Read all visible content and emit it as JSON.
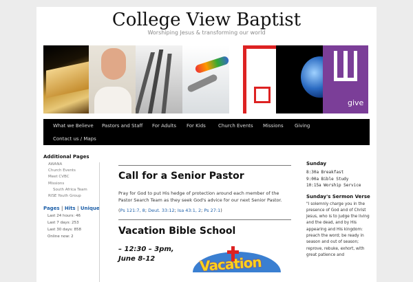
{
  "site": {
    "title": "College View Baptist",
    "tagline": "Worshiping Jesus & transforming our world"
  },
  "banner": {
    "give_label": "give"
  },
  "nav": {
    "items": [
      "What we Believe",
      "Pastors and Staff",
      "For Adults",
      "For Kids",
      "Church Events",
      "Missions",
      "Giving",
      "Contact us / Maps"
    ]
  },
  "sidebar_left": {
    "heading": "Additional Pages",
    "pages": [
      "AWANA",
      "Church Events",
      "Meet CVBC",
      "Missions",
      "South Africa Team",
      "RISE Youth Group"
    ],
    "stats_links": [
      "Pages",
      "Hits",
      "Unique"
    ],
    "stats_sep": "|",
    "stats": [
      "Last 24 hours: 46",
      "Last 7 days: 253",
      "Last 30 days: 858",
      "Online now: 2"
    ]
  },
  "main": {
    "post1": {
      "title": "Call for a Senior Pastor",
      "body": "Pray for God to put His hedge of protection around each member of the Pastor Search Team as they seek God's advice for our next Senior Pastor.",
      "refs_open": "(",
      "refs": [
        "Ps 121:7, 8",
        "Deut. 33:12",
        "Isa 43:1, 2",
        "Ps 27:1"
      ],
      "refs_sep": "; ",
      "refs_close": ")"
    },
    "post2": {
      "title": "Vacation Bible School",
      "time": "– 12:30 – 3pm,",
      "date": "June 8-12",
      "image_text": "Vacation"
    }
  },
  "sidebar_right": {
    "sunday_heading": "Sunday",
    "schedule": [
      "8:30a Breakfast",
      "9:00a Bible Study",
      "10:15a Worship Service"
    ],
    "sermon_heading": "Sunday's Sermon Verse",
    "verse": "\"I solemnly charge you in the presence of God and of Christ Jesus, who is to judge the living and the dead, and by His appearing and His kingdom: preach the word; be ready in season and out of season; reprove, rebuke, exhort, with great patience and"
  }
}
